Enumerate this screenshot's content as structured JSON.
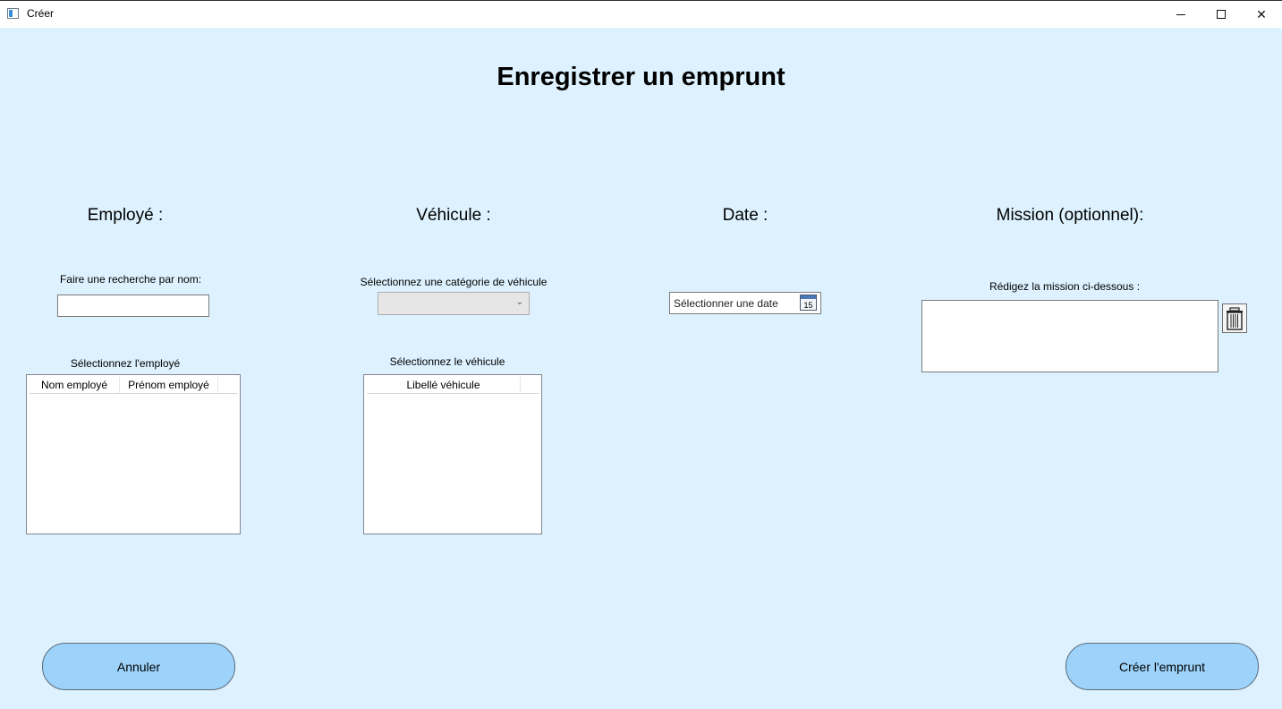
{
  "window": {
    "title": "Créer",
    "close_glyph": "✕"
  },
  "page": {
    "title": "Enregistrer un emprunt"
  },
  "employee": {
    "section_title": "Employé :",
    "search_label": "Faire une recherche par nom:",
    "search_value": "",
    "select_label": "Sélectionnez l'employé",
    "columns": [
      "Nom employé",
      "Prénom employé"
    ]
  },
  "vehicle": {
    "section_title": "Véhicule :",
    "category_label": "Sélectionnez une catégorie de véhicule",
    "category_value": "",
    "select_label": "Sélectionnez le véhicule",
    "columns": [
      "Libellé véhicule"
    ]
  },
  "date": {
    "section_title": "Date :",
    "placeholder": "Sélectionner une date",
    "calendar_day": "15"
  },
  "mission": {
    "section_title": "Mission (optionnel):",
    "label": "Rédigez la mission ci-dessous :",
    "value": ""
  },
  "buttons": {
    "cancel": "Annuler",
    "create": "Créer l'emprunt"
  },
  "colors": {
    "background": "#ddf2fe",
    "button": "#9dd3fb"
  }
}
